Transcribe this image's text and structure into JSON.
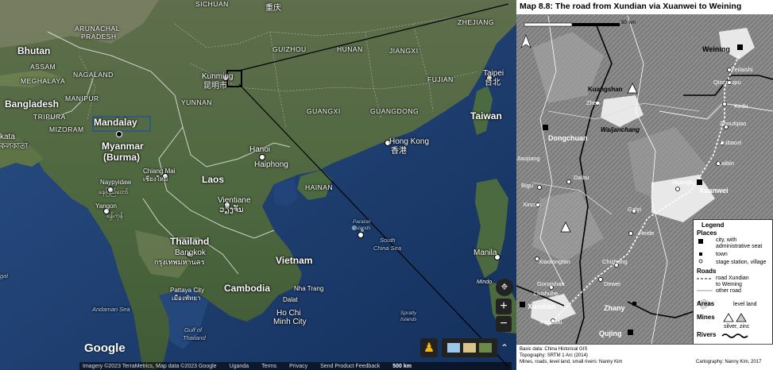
{
  "satellite": {
    "countries": [
      "Bhutan",
      "Bangladesh",
      "Myanmar",
      "(Burma)",
      "Laos",
      "Thailand",
      "Cambodia",
      "Vietnam",
      "Taiwan"
    ],
    "provinces": [
      "ARUNACHAL",
      "PRADESH",
      "ASSAM",
      "MEGHALAYA",
      "NAGALAND",
      "MANIPUR",
      "TRIPURA",
      "MIZORAM",
      "YUNNAN",
      "GUIZHOU",
      "HUNAN",
      "JIANGXI",
      "FUJIAN",
      "ZHEJIANG",
      "GUANGXI",
      "GUANGDONG",
      "HAINAN",
      "SICHUAN"
    ],
    "cities": [
      "Mandalay",
      "Kunming",
      "昆明市",
      "Hanoi",
      "Haiphong",
      "Hong Kong",
      "香港",
      "Taipei",
      "台北",
      "Vientiane",
      "ວຽງຈັນ",
      "Chiang Mai",
      "เชียงใหม่",
      "Naypyidaw",
      "နေပြည်တော်",
      "Yangon",
      "ရန်ကုန်",
      "Bangkok",
      "กรุงเทพมหานคร",
      "Pattaya City",
      "เมืองพัทยา",
      "Nha Trang",
      "Dalat",
      "Ho Chi",
      "Minh City",
      "Manila",
      "kata",
      "কলকাতা",
      "重庆",
      "Mindo"
    ],
    "seas": [
      "Andaman Sea",
      "Gulf of",
      "Thailand",
      "South",
      "China Sea",
      "Paracel",
      "Islands",
      "Spratly",
      "Islands",
      "gal"
    ],
    "google_logo": "Google",
    "attribution": [
      "Imagery ©2023 TerraMetrics, Map data ©2023 Google",
      "Uganda",
      "Terms",
      "Privacy",
      "Send Product Feedback",
      "500 km"
    ],
    "controls": {
      "zoom_in": "+",
      "zoom_out": "−"
    }
  },
  "inset": {
    "title": "Map 8.8: The road from Xundian via Xuanwei to Weining",
    "scale_end": "50",
    "scale_unit": "km",
    "places": [
      "Weining",
      "Feilaishi",
      "Qingtoupu",
      "Kedu",
      "Zhoufqiao",
      "Jiubaozi",
      "Laibin",
      "Kuangshan",
      "Zheh",
      "Dongchuan",
      "Wa/janchang",
      "Xuanwei",
      "Huanglu",
      "Galyi",
      "Heide",
      "Chizhang",
      "Dewei",
      "Daibu",
      "Bigu",
      "Xincun",
      "Xiaolongtan",
      "Gongshan",
      "Liushuhe",
      "Xundian",
      "Fadatou",
      "Zhany",
      "Qujing",
      "Jiaojiang"
    ],
    "legend": {
      "title": "Legend",
      "places_header": "Places",
      "places": [
        "city, with",
        "administrative seat",
        "town",
        "stage station, village"
      ],
      "roads_header": "Roads",
      "roads": [
        "road Xundian",
        "to Weining",
        "other road"
      ],
      "areas_header": "Areas",
      "areas": [
        "level land"
      ],
      "mines_header": "Mines",
      "mines": [
        "silver, zinc"
      ],
      "rivers_header": "Rivers"
    },
    "credits": [
      "Basic data: China Historical GIS",
      "Topography: SRTM 1 Arc (2014)",
      "Mines, roads, level land, small rivers: Nanny Kim",
      "Cartography: Nanny Kim, 2017"
    ]
  },
  "colors": {
    "sea": "#1f3f72",
    "land": "#55704a",
    "inset_land": "#8a8a8a"
  }
}
